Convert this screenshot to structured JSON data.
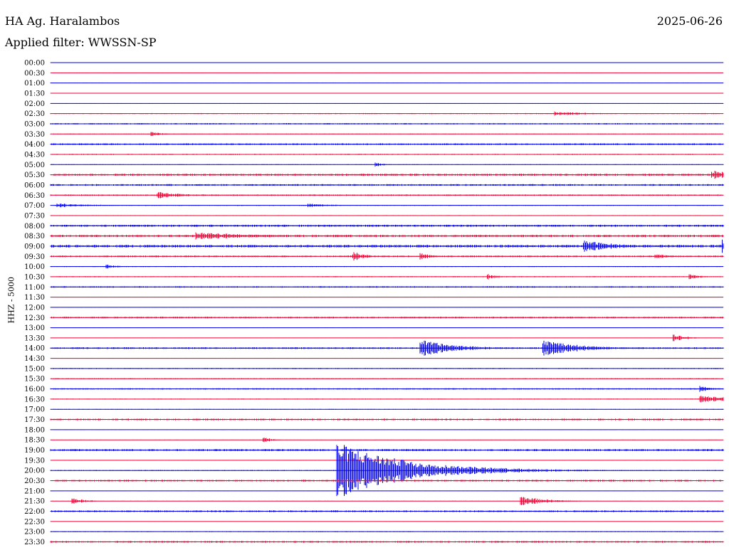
{
  "header": {
    "station": "HA Ag. Haralambos",
    "date": "2025-06-26",
    "filter": "Applied filter: WWSSN-SP"
  },
  "chart_data": {
    "type": "line",
    "title": "HA Ag. Haralambos",
    "date": "2025-06-26",
    "filter": "WWSSN-SP",
    "ylabel": "HHZ - 5000",
    "colors": [
      "#0000ee",
      "#ee0033"
    ],
    "rows": [
      "00:00",
      "00:30",
      "01:00",
      "01:30",
      "02:00",
      "02:30",
      "03:00",
      "03:30",
      "04:00",
      "04:30",
      "05:00",
      "05:30",
      "06:00",
      "06:30",
      "07:00",
      "07:30",
      "08:00",
      "08:30",
      "09:00",
      "09:30",
      "10:00",
      "10:30",
      "11:00",
      "11:30",
      "12:00",
      "12:30",
      "13:00",
      "13:30",
      "14:00",
      "14:30",
      "15:00",
      "15:30",
      "16:00",
      "16:30",
      "17:00",
      "17:30",
      "18:00",
      "18:30",
      "19:00",
      "19:30",
      "20:00",
      "20:30",
      "21:00",
      "21:30",
      "22:00",
      "22:30",
      "23:00",
      "23:30"
    ],
    "row_minutes": 30,
    "noise": [
      0.3,
      0.3,
      0.3,
      0.3,
      0.3,
      0.6,
      0.8,
      0.4,
      1.0,
      0.6,
      0.4,
      1.2,
      1.0,
      0.8,
      0.5,
      0.5,
      1.2,
      1.3,
      1.5,
      1.0,
      0.5,
      0.6,
      0.8,
      0.3,
      0.3,
      1.0,
      0.3,
      0.3,
      1.0,
      0.3,
      0.6,
      0.6,
      0.8,
      0.5,
      0.4,
      1.0,
      0.3,
      0.3,
      1.2,
      0.3,
      0.6,
      1.0,
      0.3,
      0.3,
      1.0,
      0.3,
      0.5,
      1.0
    ],
    "events": [
      {
        "row": 5,
        "minute": 22.5,
        "amplitude": 3,
        "duration": 1.5
      },
      {
        "row": 7,
        "minute": 4.5,
        "amplitude": 3,
        "duration": 0.5
      },
      {
        "row": 10,
        "minute": 14.5,
        "amplitude": 4,
        "duration": 0.3
      },
      {
        "row": 11,
        "minute": 29.5,
        "amplitude": 6,
        "duration": 1.5
      },
      {
        "row": 13,
        "minute": 4.8,
        "amplitude": 5,
        "duration": 1.0
      },
      {
        "row": 14,
        "minute": 0.3,
        "amplitude": 3,
        "duration": 1.5
      },
      {
        "row": 14,
        "minute": 11.5,
        "amplitude": 3,
        "duration": 1.0
      },
      {
        "row": 17,
        "minute": 6.5,
        "amplitude": 6,
        "duration": 1.0
      },
      {
        "row": 17,
        "minute": 6.8,
        "amplitude": 5,
        "duration": 2.5
      },
      {
        "row": 18,
        "minute": 23.8,
        "amplitude": 8,
        "duration": 1.5
      },
      {
        "row": 18,
        "minute": 30.0,
        "amplitude": 10,
        "duration": 1.0
      },
      {
        "row": 19,
        "minute": 13.5,
        "amplitude": 7,
        "duration": 0.5
      },
      {
        "row": 19,
        "minute": 16.5,
        "amplitude": 5,
        "duration": 0.5
      },
      {
        "row": 19,
        "minute": 27.0,
        "amplitude": 4,
        "duration": 0.5
      },
      {
        "row": 20,
        "minute": 2.5,
        "amplitude": 3,
        "duration": 0.5
      },
      {
        "row": 21,
        "minute": 19.5,
        "amplitude": 4,
        "duration": 0.5
      },
      {
        "row": 21,
        "minute": 28.5,
        "amplitude": 4,
        "duration": 0.5
      },
      {
        "row": 27,
        "minute": 27.8,
        "amplitude": 6,
        "duration": 0.5
      },
      {
        "row": 28,
        "minute": 16.5,
        "amplitude": 12,
        "duration": 1.5
      },
      {
        "row": 28,
        "minute": 22.0,
        "amplitude": 12,
        "duration": 1.5
      },
      {
        "row": 32,
        "minute": 29.0,
        "amplitude": 4,
        "duration": 0.5
      },
      {
        "row": 33,
        "minute": 29.0,
        "amplitude": 5,
        "duration": 1.5
      },
      {
        "row": 37,
        "minute": 9.5,
        "amplitude": 5,
        "duration": 0.3
      },
      {
        "row": 40,
        "minute": 12.8,
        "amplitude": 40,
        "duration": 3.0
      },
      {
        "row": 40,
        "minute": 15.8,
        "amplitude": 5,
        "duration": 1.5
      },
      {
        "row": 43,
        "minute": 1.0,
        "amplitude": 5,
        "duration": 0.5
      },
      {
        "row": 43,
        "minute": 21.0,
        "amplitude": 7,
        "duration": 1.0
      }
    ]
  }
}
